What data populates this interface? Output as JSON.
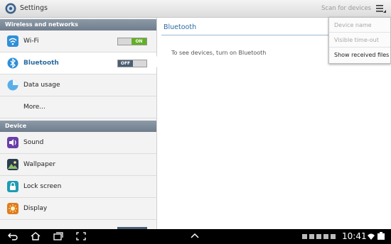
{
  "app": {
    "title": "Settings"
  },
  "toolbar": {
    "scan_label": "Scan for devices"
  },
  "sidebar": {
    "sections": [
      {
        "label": "Wireless and networks"
      },
      {
        "label": "Device"
      }
    ],
    "items": [
      {
        "label": "Wi-Fi",
        "icon": "wifi-icon",
        "toggle": "ON"
      },
      {
        "label": "Bluetooth",
        "icon": "bluetooth-icon",
        "toggle": "OFF",
        "selected": true
      },
      {
        "label": "Data usage",
        "icon": "data-usage-icon"
      },
      {
        "label": "More..."
      },
      {
        "label": "Sound",
        "icon": "sound-icon"
      },
      {
        "label": "Wallpaper",
        "icon": "wallpaper-icon"
      },
      {
        "label": "Lock screen",
        "icon": "lock-icon"
      },
      {
        "label": "Display",
        "icon": "display-icon"
      }
    ]
  },
  "detail": {
    "title": "Bluetooth",
    "message": "To see devices, turn on Bluetooth"
  },
  "menu": {
    "items": [
      {
        "label": "Device name",
        "enabled": false
      },
      {
        "label": "Visible time-out",
        "enabled": false
      },
      {
        "label": "Show received files",
        "enabled": true
      }
    ]
  },
  "statusbar": {
    "time": "10:41"
  },
  "colors": {
    "accent": "#2a6aa0",
    "toggle_on": "#63b023",
    "toggle_off": "#4b5e73",
    "section_header": "#7b8897"
  }
}
